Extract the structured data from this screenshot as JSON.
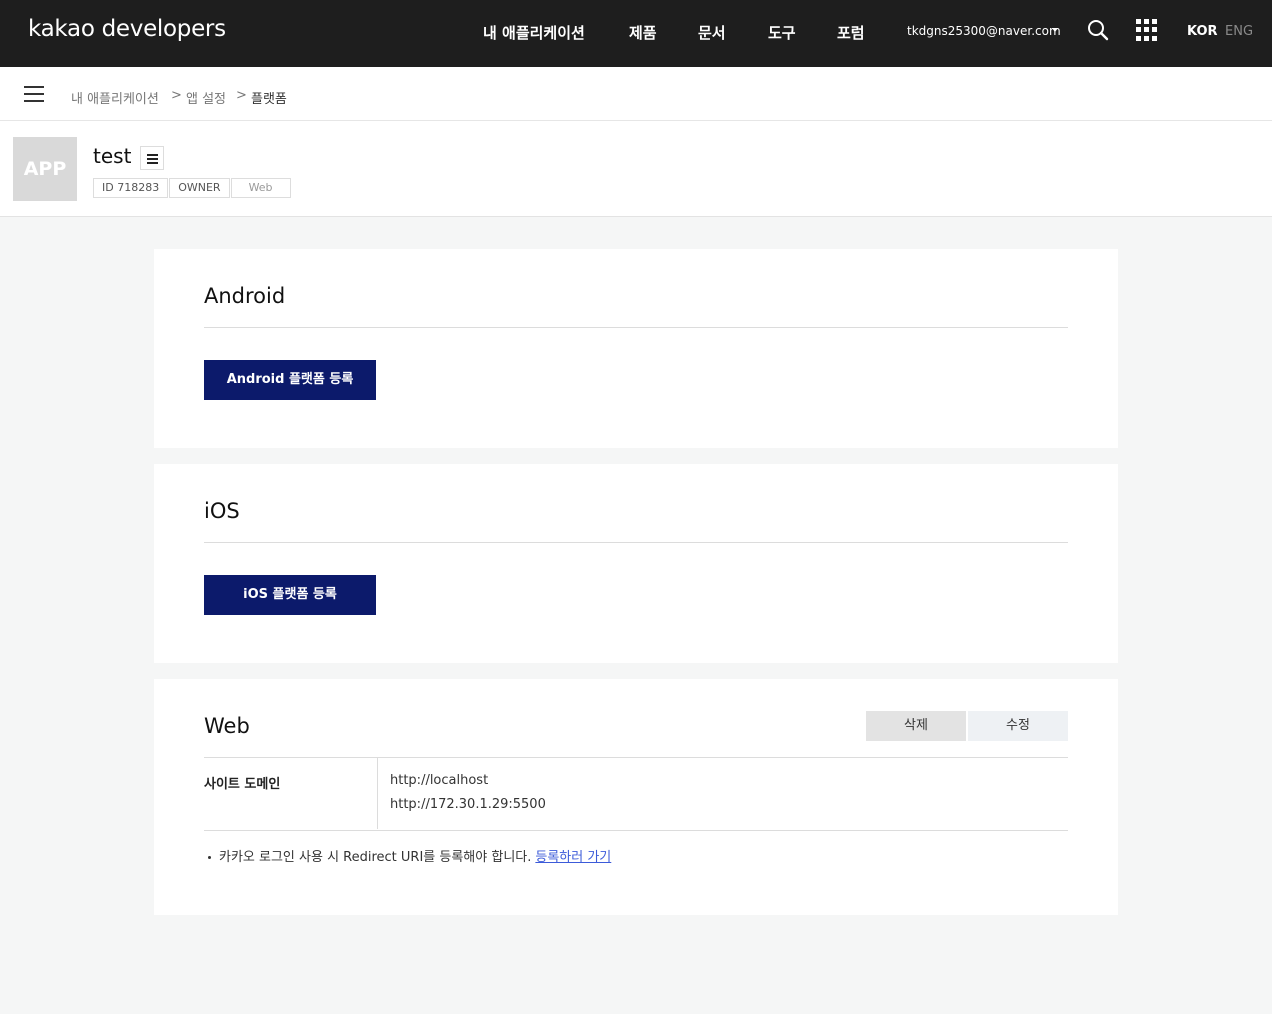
{
  "header": {
    "logo": "kakao developers",
    "nav": [
      "내 애플리케이션",
      "제품",
      "문서",
      "도구",
      "포럼"
    ],
    "user_email": "tkdgns25300@naver.com",
    "lang_active": "KOR",
    "lang_other": "ENG"
  },
  "breadcrumb": {
    "items": [
      "내 애플리케이션",
      "앱 설정",
      "플랫폼"
    ],
    "separator": ">"
  },
  "app": {
    "thumb_text": "APP",
    "name": "test",
    "tags": [
      "ID 718283",
      "OWNER",
      "Web"
    ]
  },
  "android": {
    "title": "Android",
    "register_label": "Android 플랫폼 등록"
  },
  "ios": {
    "title": "iOS",
    "register_label": "iOS 플랫폼 등록"
  },
  "web": {
    "title": "Web",
    "delete_label": "삭제",
    "edit_label": "수정",
    "site_domain_label": "사이트 도메인",
    "domains": [
      "http://localhost",
      "http://172.30.1.29:5500"
    ],
    "notice": "카카오 로그인 사용 시 Redirect URI를 등록해야 합니다.",
    "notice_link": "등록하러 가기"
  },
  "colors": {
    "topbar": "#1e1e1e",
    "primary_button": "#0c1a6b",
    "link": "#3c5bd9"
  }
}
